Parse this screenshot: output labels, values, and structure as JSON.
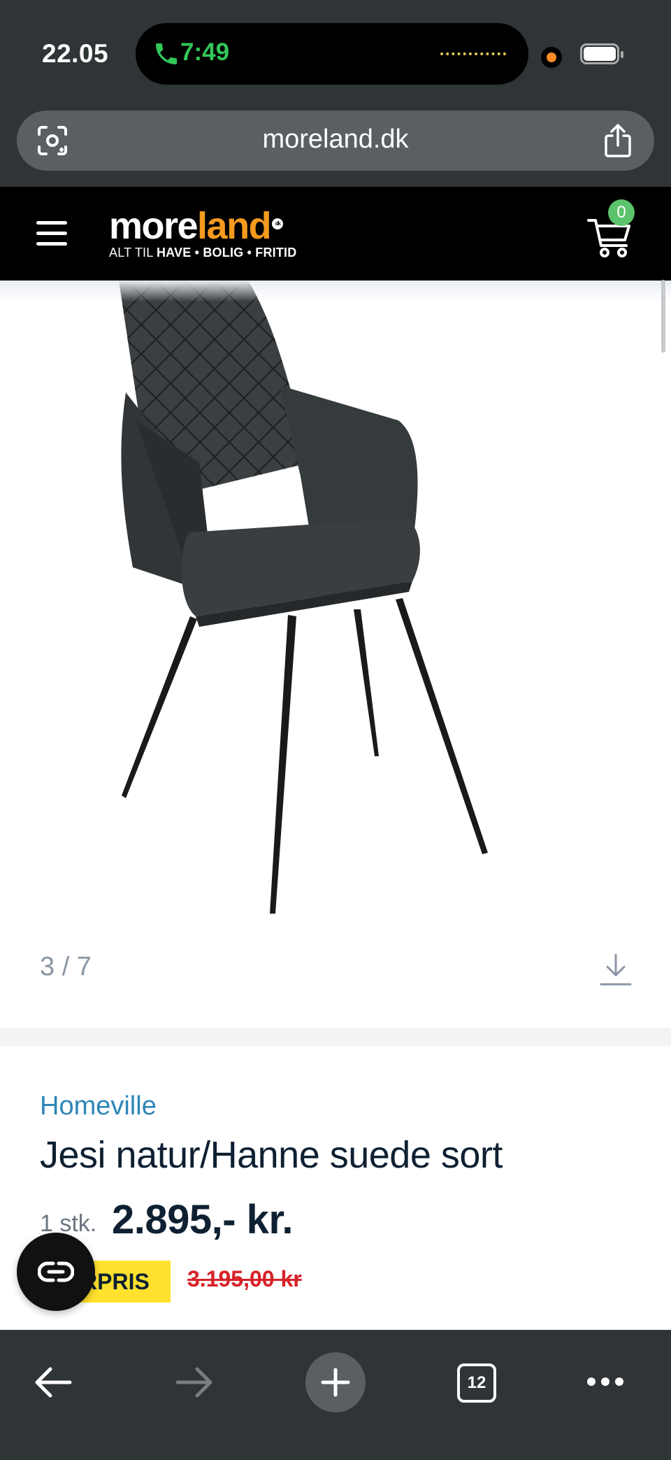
{
  "status_bar": {
    "time": "22.05",
    "call_time": "7:49"
  },
  "browser": {
    "url": "moreland.dk",
    "tab_count": "12"
  },
  "site": {
    "logo_more": "more",
    "logo_land": "land",
    "logo_dk": "dk",
    "logo_tag_prefix": "ALT TIL ",
    "logo_tag_items": "HAVE • BOLIG • FRITID",
    "cart_count": "0"
  },
  "gallery": {
    "counter": "3 / 7"
  },
  "product": {
    "brand": "Homeville",
    "title": "Jesi natur/Hanne suede sort",
    "qty_label": "1 stk.",
    "price": "2.895,- kr.",
    "badge": "RPRIS",
    "old_price": "3.195,00 kr"
  },
  "colors": {
    "accent_orange": "#f49a1e",
    "brand_blue": "#2e86b8",
    "badge_yellow": "#ffe12e",
    "old_price_red": "#d72228",
    "cart_badge_green": "#5bc36b"
  }
}
